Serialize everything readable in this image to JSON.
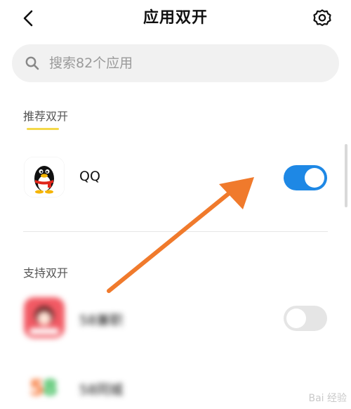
{
  "header": {
    "back_icon": "chevron-left-icon",
    "title": "应用双开",
    "settings_icon": "gear-icon"
  },
  "search": {
    "placeholder": "搜索82个应用",
    "icon": "search-icon"
  },
  "recommended": {
    "label": "推荐双开",
    "apps": [
      {
        "name": "QQ",
        "enabled": true,
        "icon": "qq-penguin-icon"
      }
    ]
  },
  "supported": {
    "label": "支持双开",
    "apps": [
      {
        "name": "58兼职",
        "enabled": false,
        "icon": "58-jianzhi-icon"
      },
      {
        "name": "58同城",
        "icon": "58-tongcheng-icon"
      }
    ]
  },
  "colors": {
    "toggle_on": "#1e88e5",
    "toggle_off": "#e5e5e5",
    "accent_underline": "#f4d949",
    "annotation_arrow": "#f07a2c"
  },
  "watermark": {
    "text": "Bai 经验"
  }
}
